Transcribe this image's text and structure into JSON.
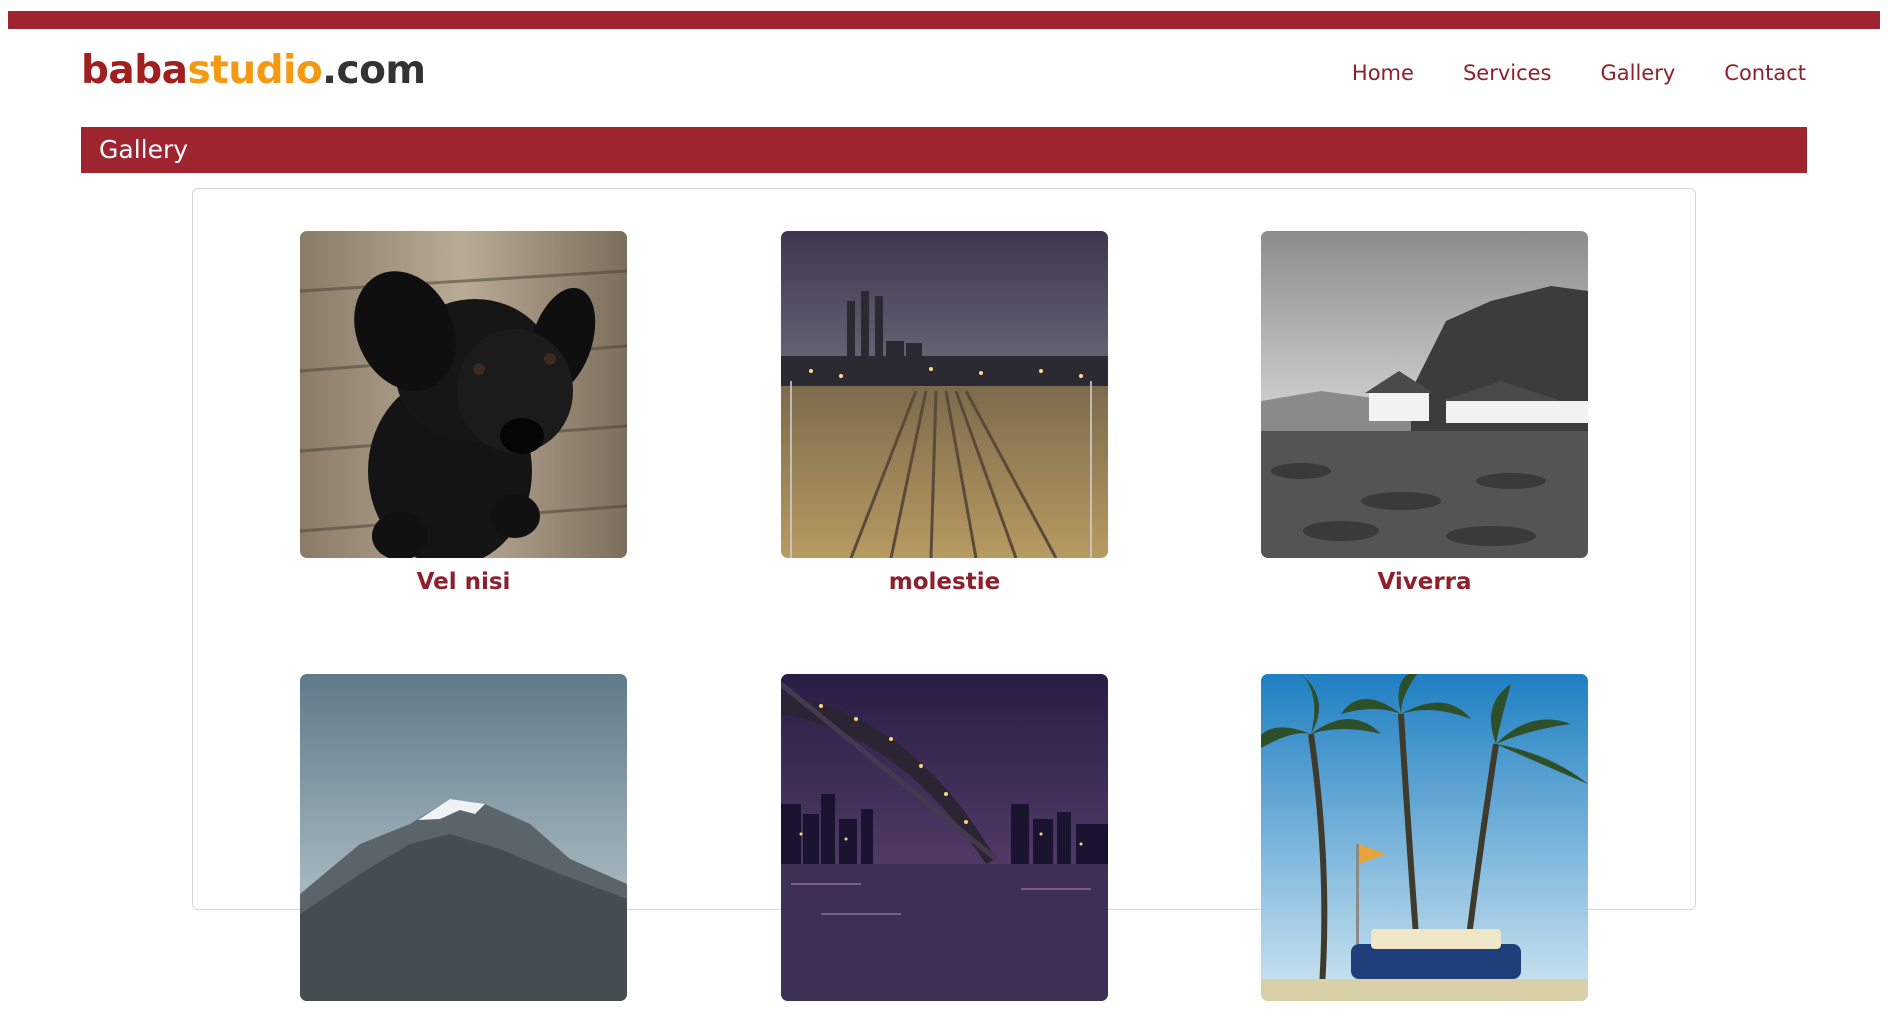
{
  "brand": {
    "logo_part1": "baba",
    "logo_part2": "studio",
    "logo_part3": ".com"
  },
  "nav": {
    "items": [
      {
        "label": "Home"
      },
      {
        "label": "Services"
      },
      {
        "label": "Gallery"
      },
      {
        "label": "Contact"
      }
    ]
  },
  "section": {
    "title": "Gallery"
  },
  "gallery": {
    "items": [
      {
        "caption": "Vel nisi"
      },
      {
        "caption": "molestie"
      },
      {
        "caption": "Viverra"
      },
      {
        "caption": ""
      },
      {
        "caption": ""
      },
      {
        "caption": ""
      }
    ]
  },
  "colors": {
    "accent": "#9e2430",
    "link": "#8f1f2a",
    "logo_red": "#a01f1f",
    "logo_orange": "#f39a12",
    "logo_dark": "#333333"
  }
}
